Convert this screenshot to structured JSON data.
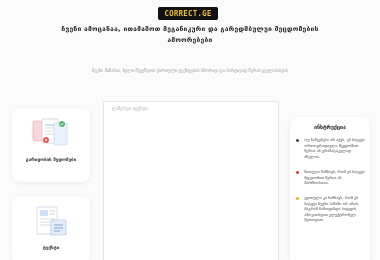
{
  "logo": {
    "text": "CORRECT.GE"
  },
  "headline": "ჩვენი ამოცანაა, ითამაშოთ მეგანიკური და გარედმბულუი შეცდომების ამოორებები",
  "subtitle": "ჩვენი მიზანია, ხელი შევუწყოთ ქართული ტექსტების სწორად და მარტივად წერას ყველასთვის",
  "cards": [
    {
      "label": "გარიყობის შედომები",
      "icon": "documents-icon"
    },
    {
      "label": "ტექსტი",
      "icon": "blog-page-icon"
    }
  ],
  "editor": {
    "placeholder": "დაწერეთ ტექსტი"
  },
  "instructions": {
    "title": "ინსტრუქცია",
    "items": [
      {
        "color": "#4a4a4a",
        "text": "ოუ ნაჩვენება არ აქვს, ეს სიტყვა ორთოგრაფიული შეცდომით წერია ან გრამატიკულად ძნელია."
      },
      {
        "color": "#e53935",
        "text": "წითელი ნიშნავს, რომ ეს სიტყვა შეცდომით წერია ან მარჩხობთია."
      },
      {
        "color": "#f0b429",
        "text": "ყვითელი კი ნიშნავს, რომ ეს სიტყვა ჩვენი ბაზაში არ არის, მაგრამ ჩამოფინდა სიტყვის ამოკითხვათ ელექტრონულ მეთოდით."
      }
    ]
  },
  "colors": {
    "accent": "#f2c230",
    "error": "#e53935",
    "warning": "#f0b429"
  }
}
